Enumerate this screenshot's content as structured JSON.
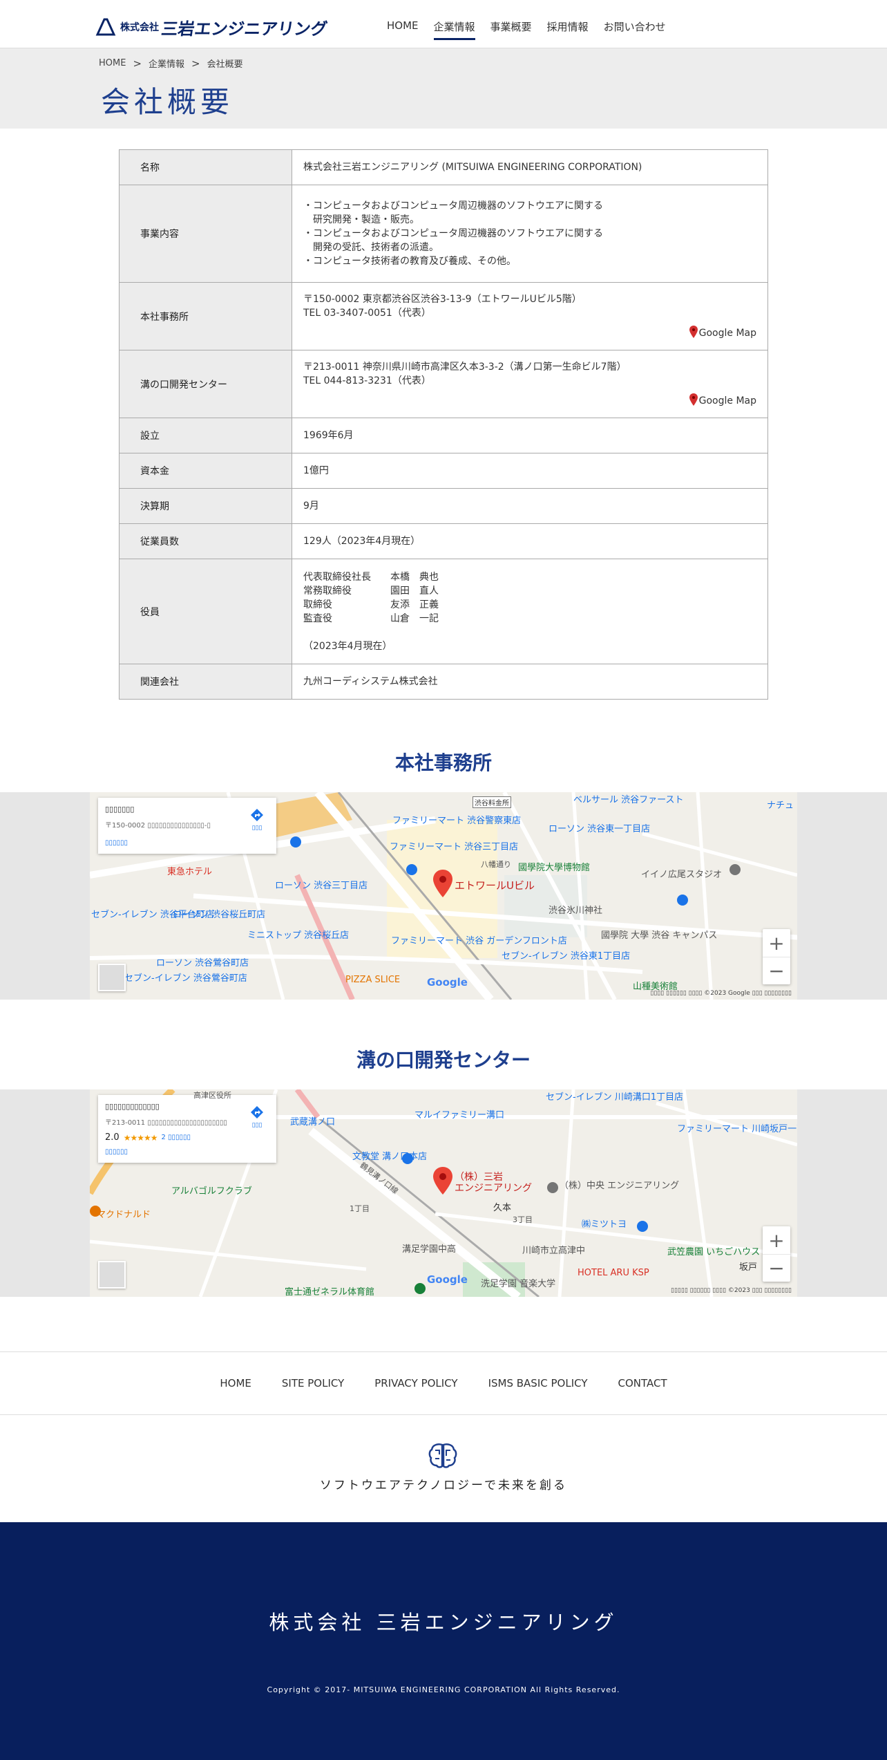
{
  "header": {
    "logo_small": "株式会社",
    "logo_big": "三岩エンジニアリング",
    "nav": [
      "HOME",
      "企業情報",
      "事業概要",
      "採用情報",
      "お問い合わせ"
    ]
  },
  "breadcrumb": [
    "HOME",
    "企業情報",
    "会社概要"
  ],
  "page_title": "会社概要",
  "company": {
    "rows": [
      {
        "label": "名称",
        "value": "株式会社三岩エンジニアリング (MITSUIWA ENGINEERING CORPORATION)"
      },
      {
        "label": "事業内容",
        "lines": [
          "・コンピュータおよびコンピュータ周辺機器のソフトウエアに関する",
          "　研究開発・製造・販売。",
          "・コンピュータおよびコンピュータ周辺機器のソフトウエアに関する",
          "　開発の受託、技術者の派遣。",
          "・コンピュータ技術者の教育及び養成、その他。"
        ]
      },
      {
        "label": "本社事務所",
        "lines": [
          "〒150-0002 東京都渋谷区渋谷3-13-9（エトワールUビル5階）",
          "TEL 03-3407-0051（代表）"
        ],
        "map_link": "Google Map"
      },
      {
        "label": "溝の口開発センター",
        "lines": [
          "〒213-0011 神奈川県川崎市高津区久本3-3-2（溝ノ口第一生命ビル7階）",
          "TEL 044-813-3231（代表）"
        ],
        "map_link": "Google Map"
      },
      {
        "label": "設立",
        "value": "1969年6月"
      },
      {
        "label": "資本金",
        "value": "1億円"
      },
      {
        "label": "決算期",
        "value": "9月"
      },
      {
        "label": "従業員数",
        "value": "129人（2023年4月現在）"
      },
      {
        "label": "役員",
        "officers": [
          {
            "role": "代表取締役社長",
            "name": "本橋　典也"
          },
          {
            "role": "常務取締役",
            "name": "園田　直人"
          },
          {
            "role": "取締役",
            "name": "友添　正義"
          },
          {
            "role": "監査役",
            "name": "山倉　一記"
          }
        ],
        "note": "（2023年4月現在）"
      },
      {
        "label": "関連会社",
        "value": "九州コーディシステム株式会社"
      }
    ]
  },
  "sections": {
    "hq_title": "本社事務所",
    "mizo_title": "溝の口開発センター"
  },
  "map1": {
    "card_title": "▯▯▯▯▯▯▯",
    "card_addr": "〒150-0002 ▯▯▯▯▯▯▯▯▯▯▯▯▯▯▯-▯",
    "card_link": "▯▯▯▯▯▯",
    "card_dir": "▯▯▯",
    "pin_label": "エトワールUビル",
    "labels": [
      "ファミリーマート 渋谷警察東店",
      "ファミリーマート 渋谷三丁目店",
      "ローソン 渋谷東一丁目店",
      "國學院大學博物館",
      "イイノ広尾スタジオ",
      "ローソン 渋谷三丁目店",
      "ローソン 渋谷桜丘町店",
      "ミニストップ 渋谷桜丘店",
      "ファミリーマート 渋谷 ガーデンフロント店",
      "セブン-イレブン 渋谷東1丁目店",
      "渋谷氷川神社",
      "國學院 大學 渋谷 キャンパス",
      "ローソン 渋谷鶯谷町店",
      "PIZZA SLICE",
      "山種美術館",
      "セブン-イレブン 渋谷平台町店",
      "セブン-イレブン 渋谷鶯谷町店",
      "東急ホテル",
      "八幡通り",
      "渋谷料金所",
      "ベルサール 渋谷ファースト",
      "ナチュ"
    ],
    "google": "Google",
    "attrib": "▯▯▯▯ ▯▯▯▯▯▯  ▯▯▯▯ ©2023 Google  ▯▯▯  ▯▯▯▯▯▯▯▯"
  },
  "map2": {
    "card_title": "▯▯▯▯▯▯▯▯▯▯▯▯▯",
    "card_addr": "〒213-0011 ▯▯▯▯▯▯▯▯▯▯▯▯▯▯▯▯▯▯▯▯▯",
    "rating": "2.0",
    "stars": "★★★★★",
    "reviews": "2 ▯▯▯▯▯▯",
    "card_link": "▯▯▯▯▯▯",
    "card_dir": "▯▯▯",
    "pin_label_1": "（株）三岩",
    "pin_label_2": "エンジニアリング",
    "labels": [
      "マルイファミリー溝口",
      "セブン-イレブン 川崎溝口1丁目店",
      "ファミリーマート 川崎坂戸一丁目店",
      "文教堂 溝ノ口本店",
      "（株）中央 エンジニアリング",
      "久本",
      "アルバゴルフクラブ",
      "マクドナルド",
      "㈱ミツトヨ",
      "武笠農園 いちごハウス",
      "川崎市立高津中",
      "溝足学園中高",
      "HOTEL ARU KSP",
      "富士通ゼネラル体育館",
      "洗足学園 音楽大学",
      "坂戸",
      "1丁目",
      "3丁目",
      "武蔵溝ノ口",
      "鶴見溝ノ口線",
      "高津区役所"
    ],
    "google": "Google",
    "attrib": "▯▯▯▯▯ ▯▯▯▯▯▯  ▯▯▯▯ ©2023  ▯▯▯  ▯▯▯▯▯▯▯▯"
  },
  "footer": {
    "links": [
      "HOME",
      "SITE POLICY",
      "PRIVACY POLICY",
      "ISMS BASIC POLICY",
      "CONTACT"
    ],
    "tagline": "ソフトウエアテクノロジーで未来を創る",
    "corp_name": "株式会社 三岩エンジニアリング",
    "copyright": "Copyright © 2017- MITSUIWA ENGINEERING CORPORATION All Rights Reserved."
  },
  "colors": {
    "brand": "#0a2466",
    "title_blue": "#1e3f8e",
    "footer_dark": "#081f5d",
    "map_pin": "#e53935"
  }
}
